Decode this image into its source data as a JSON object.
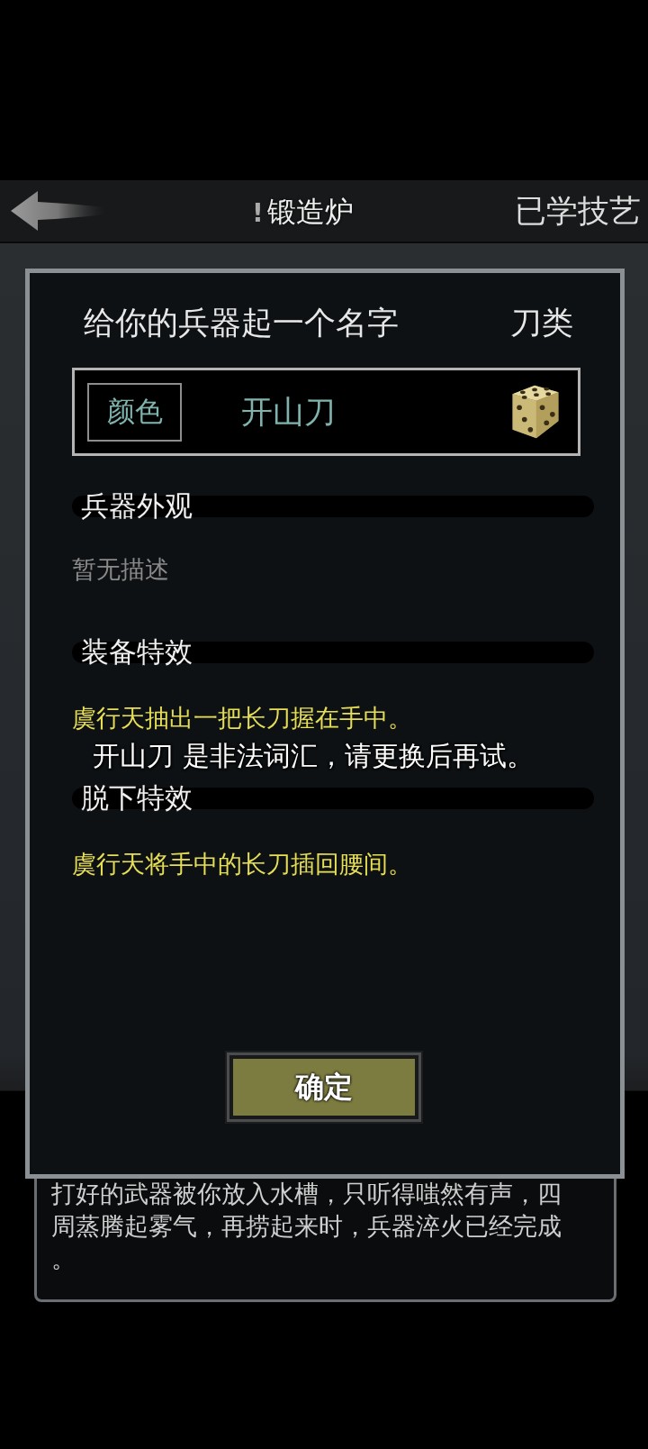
{
  "header": {
    "title_mark": "!",
    "title": "锻造炉",
    "right_link": "已学技艺"
  },
  "dialog": {
    "title": "给你的兵器起一个名字",
    "category": "刀类",
    "name_field": {
      "color_button": "颜色",
      "value": "开山刀"
    },
    "sections": [
      {
        "heading": "兵器外观",
        "text": "暂无描述",
        "kind": "empty"
      },
      {
        "heading": "装备特效",
        "text": "虞行天抽出一把长刀握在手中。",
        "kind": "effect"
      },
      {
        "heading": "脱下特效",
        "text": "虞行天将手中的长刀插回腰间。",
        "kind": "effect"
      }
    ],
    "toast": "开山刀 是非法词汇，请更换后再试。",
    "confirm_button": "确定"
  },
  "log_panel": {
    "lines": [
      "打好的武器被你放入水槽，只听得嗤然有声，四",
      "周蒸腾起雾气，再捞起来时，兵器淬火已经完成",
      "。"
    ]
  }
}
